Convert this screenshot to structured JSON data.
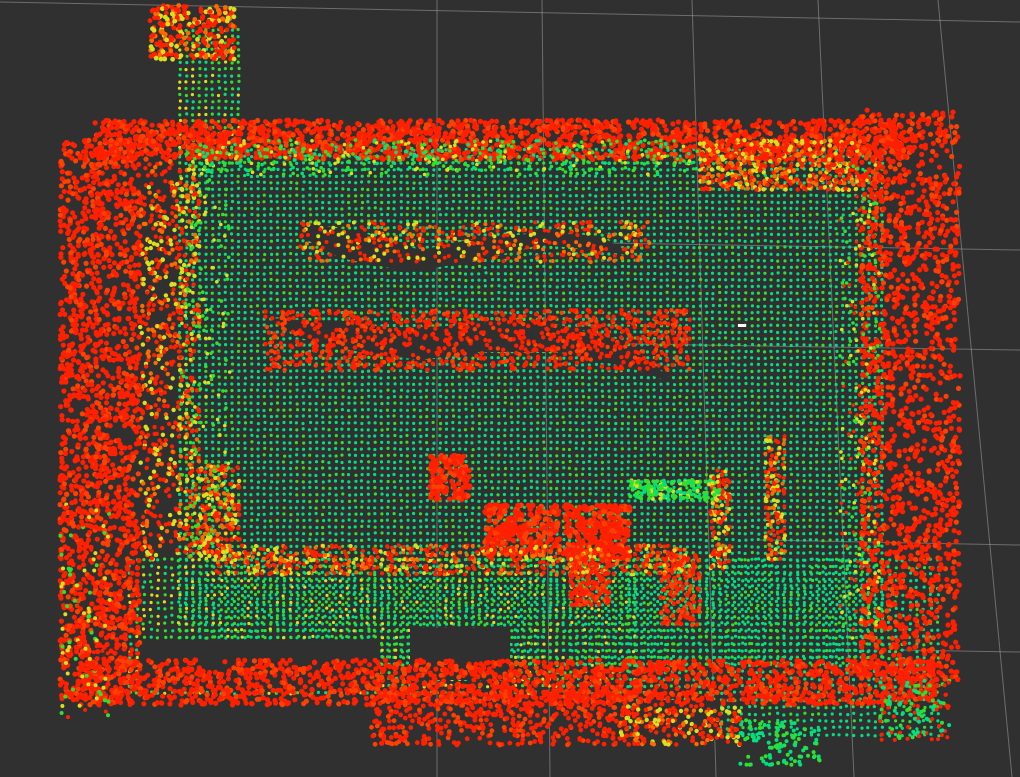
{
  "view": {
    "type": "3d-point-cloud-occupancy-map",
    "background_color": "#303030",
    "grid_color": "#a0a0a0",
    "grid": true,
    "color_scale": [
      "#00e080",
      "#30e030",
      "#d8e020",
      "#ff2000"
    ],
    "labels": []
  }
}
